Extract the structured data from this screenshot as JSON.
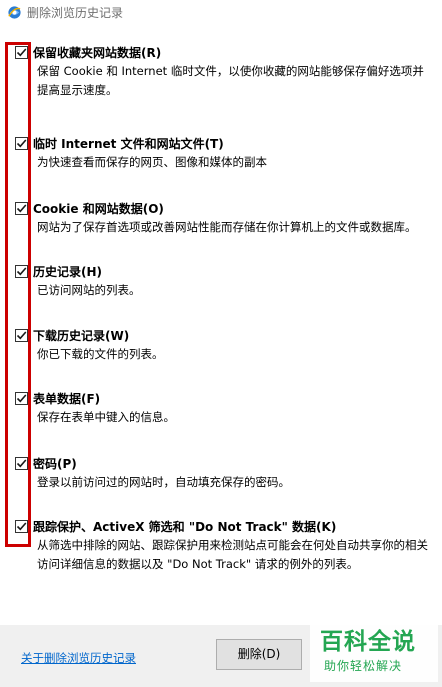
{
  "window": {
    "title": "删除浏览历史记录",
    "icon": "ie-globe-icon"
  },
  "options": [
    {
      "title": "保留收藏夹网站数据(R)",
      "desc": "保留 Cookie 和 Internet 临时文件，以使你收藏的网站能够保存偏好选项并提高显示速度。",
      "checked": true
    },
    {
      "title": "临时 Internet 文件和网站文件(T)",
      "desc": "为快速查看而保存的网页、图像和媒体的副本",
      "checked": true
    },
    {
      "title": "Cookie 和网站数据(O)",
      "desc": "网站为了保存首选项或改善网站性能而存储在你计算机上的文件或数据库。",
      "checked": true
    },
    {
      "title": "历史记录(H)",
      "desc": "已访问网站的列表。",
      "checked": true
    },
    {
      "title": "下载历史记录(W)",
      "desc": "你已下载的文件的列表。",
      "checked": true
    },
    {
      "title": "表单数据(F)",
      "desc": "保存在表单中键入的信息。",
      "checked": true
    },
    {
      "title": "密码(P)",
      "desc": "登录以前访问过的网站时，自动填充保存的密码。",
      "checked": true
    },
    {
      "title": "跟踪保护、ActiveX 筛选和 \"Do Not Track\" 数据(K)",
      "desc": "从筛选中排除的网站、跟踪保护用来检测站点可能会在何处自动共享你的相关访问详细信息的数据以及 \"Do Not Track\" 请求的例外的列表。",
      "checked": true
    }
  ],
  "footer": {
    "about_link": "关于删除浏览历史记录",
    "delete_button": "删除(D)"
  },
  "watermark": {
    "title": "百科全说",
    "subtitle": "助你轻松解决"
  },
  "colors": {
    "highlight": "#cc0000",
    "link": "#0066cc",
    "watermark": "#1aa34a"
  }
}
